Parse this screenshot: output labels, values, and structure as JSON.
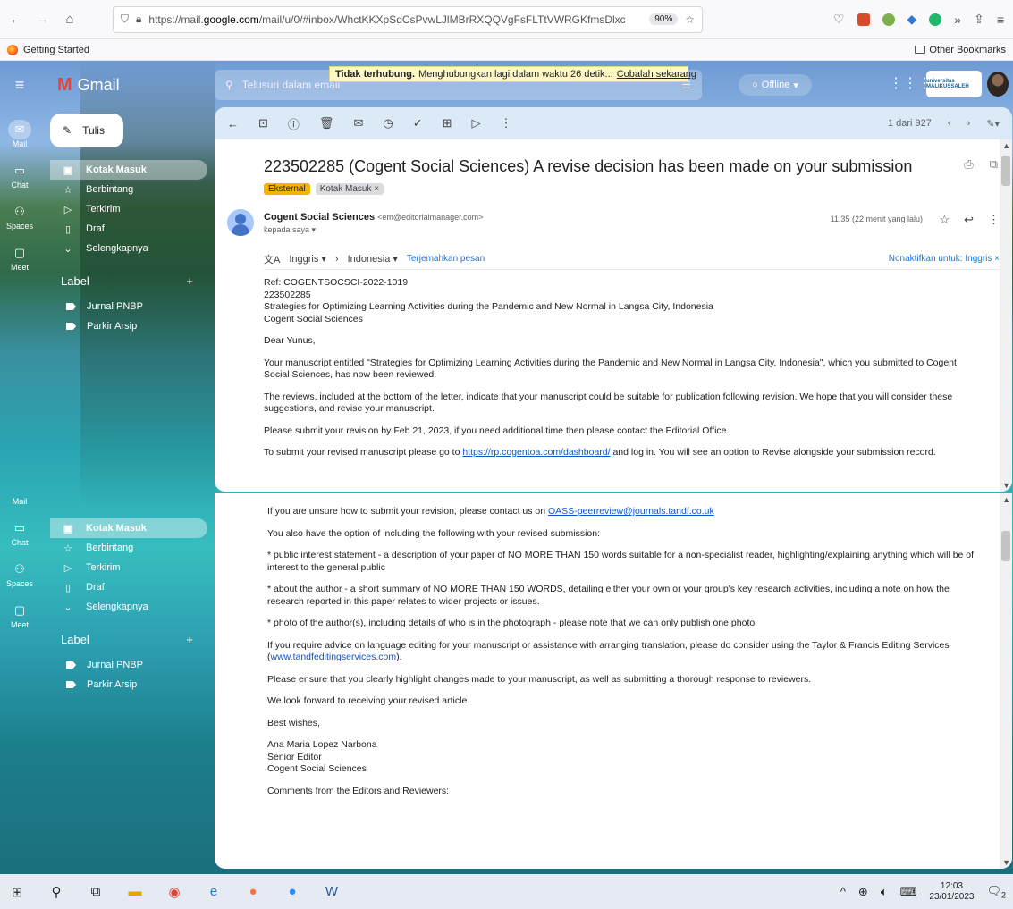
{
  "browser": {
    "url_prefix": "https://mail.",
    "url_host": "google.com",
    "url_rest": "/mail/u/0/#inbox/WhctKKXpSdCsPvwLJlMBrRXQQVgFsFLTtVWRGKfmsDlxc",
    "zoom": "90%",
    "bookmark_getting_started": "Getting Started",
    "bookmark_other": "Other Bookmarks"
  },
  "gmail": {
    "brand": "Gmail",
    "search_placeholder": "Telusuri dalam email",
    "offline_label": "Offline",
    "notice_bold": "Tidak terhubung.",
    "notice_text": "Menghubungkan lagi dalam waktu 26 detik...",
    "notice_retry": "Cobalah sekarang",
    "univ_text": "universitas MALIKUSSALEH"
  },
  "rail": [
    {
      "label": "Mail",
      "icon": "mail-icon"
    },
    {
      "label": "Chat",
      "icon": "chat-icon"
    },
    {
      "label": "Spaces",
      "icon": "spaces-icon"
    },
    {
      "label": "Meet",
      "icon": "meet-icon"
    }
  ],
  "nav": {
    "compose": "Tulis",
    "items": [
      {
        "label": "Kotak Masuk",
        "icon": "inbox-icon"
      },
      {
        "label": "Berbintang",
        "icon": "star-icon"
      },
      {
        "label": "Terkirim",
        "icon": "send-icon"
      },
      {
        "label": "Draf",
        "icon": "draft-icon"
      },
      {
        "label": "Selengkapnya",
        "icon": "chevron-down-icon"
      }
    ],
    "label_heading": "Label",
    "labels": [
      "Jurnal PNBP",
      "Parkir Arsip"
    ]
  },
  "email": {
    "counter": "1 dari 927",
    "subject": "223502285 (Cogent Social Sciences) A revise decision has been made on your submission",
    "chip_external": "Eksternal",
    "chip_inbox": "Kotak Masuk ×",
    "sender_name": "Cogent Social Sciences",
    "sender_email": "<em@editorialmanager.com>",
    "to": "kepada saya ▾",
    "time": "11.35 (22 menit yang lalu)",
    "translate_from": "Inggris ▾",
    "translate_to": "Indonesia ▾",
    "translate_link": "Terjemahkan pesan",
    "translate_off": "Nonaktifkan untuk: Inggris",
    "ref_lines": [
      "Ref: COGENTSOCSCI-2022-1019",
      "223502285",
      "Strategies for Optimizing Learning Activities during the Pandemic and New Normal in Langsa City, Indonesia",
      "Cogent Social Sciences"
    ],
    "greeting": "Dear  Yunus,",
    "p1": "Your manuscript entitled \"Strategies for Optimizing Learning Activities during the Pandemic and New Normal in Langsa City, Indonesia\", which you submitted to Cogent Social Sciences, has now been reviewed.",
    "p2": "The reviews, included at the bottom of the letter, indicate that your manuscript could be suitable for publication following revision. We hope that you will consider these suggestions, and revise your manuscript.",
    "p3": "Please submit your revision by Feb 21, 2023, if you need additional time then please contact the Editorial Office.",
    "p4_before": "To submit your revised manuscript please go to ",
    "p4_link": "https://rp.cogentoa.com/dashboard/",
    "p4_after": " and log in. You will see an option to Revise alongside your submission record.",
    "p5_before": "If you are unsure how to submit your revision, please contact us on ",
    "p5_link": "OASS-peerreview@journals.tandf.co.uk",
    "p6": "You also have the option of including the following with your revised submission:",
    "p7": "* public interest statement - a description of your paper of NO MORE THAN 150 words suitable for a non-specialist reader, highlighting/explaining anything which will be of interest to the general public",
    "p8": "* about the author - a short summary of NO MORE THAN 150 WORDS, detailing either your own or your group's key research activities, including a note on how the research reported in this paper relates to wider projects or issues.",
    "p9": "* photo of the author(s), including details of who is in the photograph - please note that we can only publish one photo",
    "p10_before": "If you require advice on language editing for your manuscript or assistance with arranging translation, please do consider using the Taylor & Francis Editing Services (",
    "p10_link": "www.tandfeditingservices.com",
    "p10_after": ").",
    "p11": "Please ensure that you clearly highlight changes made to your manuscript, as well as submitting a thorough response to reviewers.",
    "p12": "We look forward to receiving your revised article.",
    "p13": "Best wishes,",
    "sig": [
      "Ana Maria Lopez Narbona",
      "Senior Editor",
      "Cogent Social Sciences"
    ],
    "p14": "Comments from the Editors and Reviewers:"
  },
  "taskbar": {
    "time": "12:03",
    "date": "23/01/2023",
    "notif_count": "2"
  }
}
